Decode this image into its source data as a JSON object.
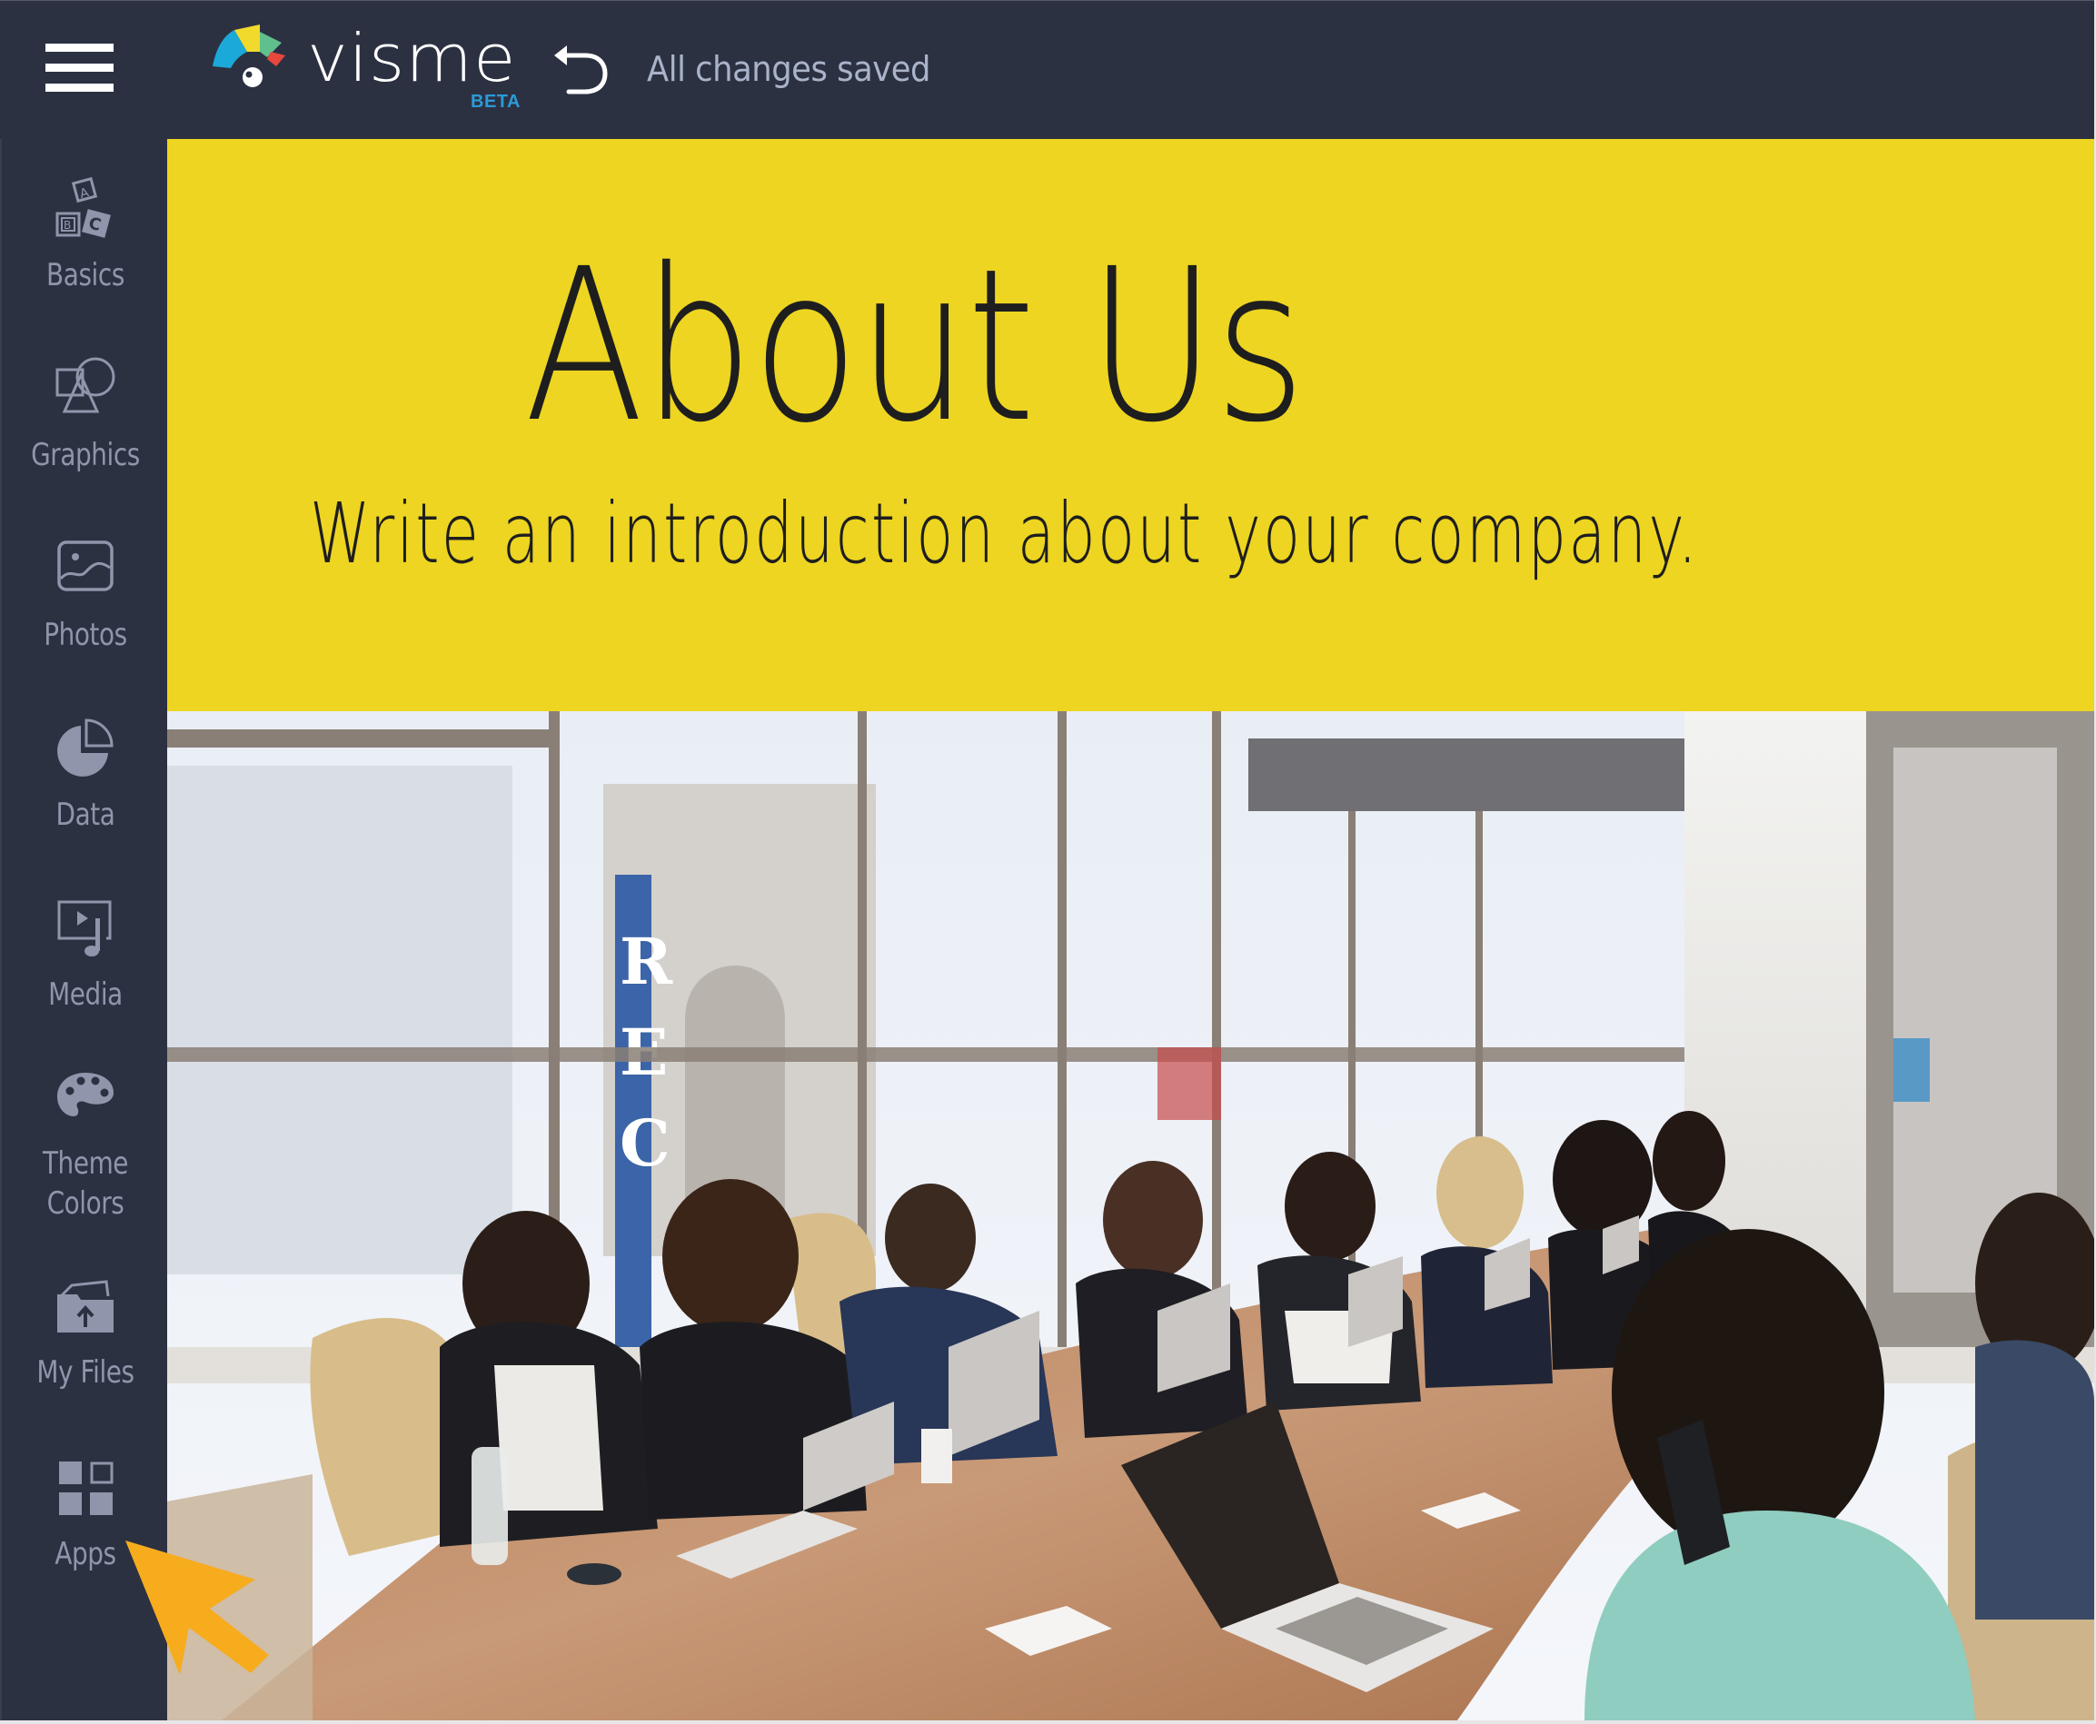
{
  "app": {
    "name": "visme",
    "badge": "BETA",
    "status": "All changes saved",
    "colors": {
      "chrome": "#2C3142",
      "sidebar_label": "#8F96AB",
      "status_text": "#A9B3C9",
      "beta": "#2A9BD7",
      "banner": "#EDD521",
      "pointer": "#F7AC1E"
    }
  },
  "header": {
    "menu_icon": "hamburger-icon",
    "undo_icon": "undo-icon"
  },
  "sidebar": {
    "items": [
      {
        "label": "Basics",
        "icon": "abc-blocks-icon"
      },
      {
        "label": "Graphics",
        "icon": "shapes-icon"
      },
      {
        "label": "Photos",
        "icon": "image-icon"
      },
      {
        "label": "Data",
        "icon": "pie-chart-icon"
      },
      {
        "label": "Media",
        "icon": "media-icon"
      },
      {
        "label": "Theme\nColors",
        "label_line1": "Theme",
        "label_line2": "Colors",
        "icon": "palette-icon"
      },
      {
        "label": "My Files",
        "icon": "upload-folder-icon"
      },
      {
        "label": "Apps",
        "icon": "apps-grid-icon"
      }
    ]
  },
  "canvas": {
    "title": "About Us",
    "subtitle": "Write an introduction about your company.",
    "photo_description": "Team meeting around a conference table with laptops",
    "window_sign_text": "REC"
  },
  "annotation": {
    "pointer_target": "Apps",
    "pointer_icon": "arrow-pointer-icon"
  }
}
